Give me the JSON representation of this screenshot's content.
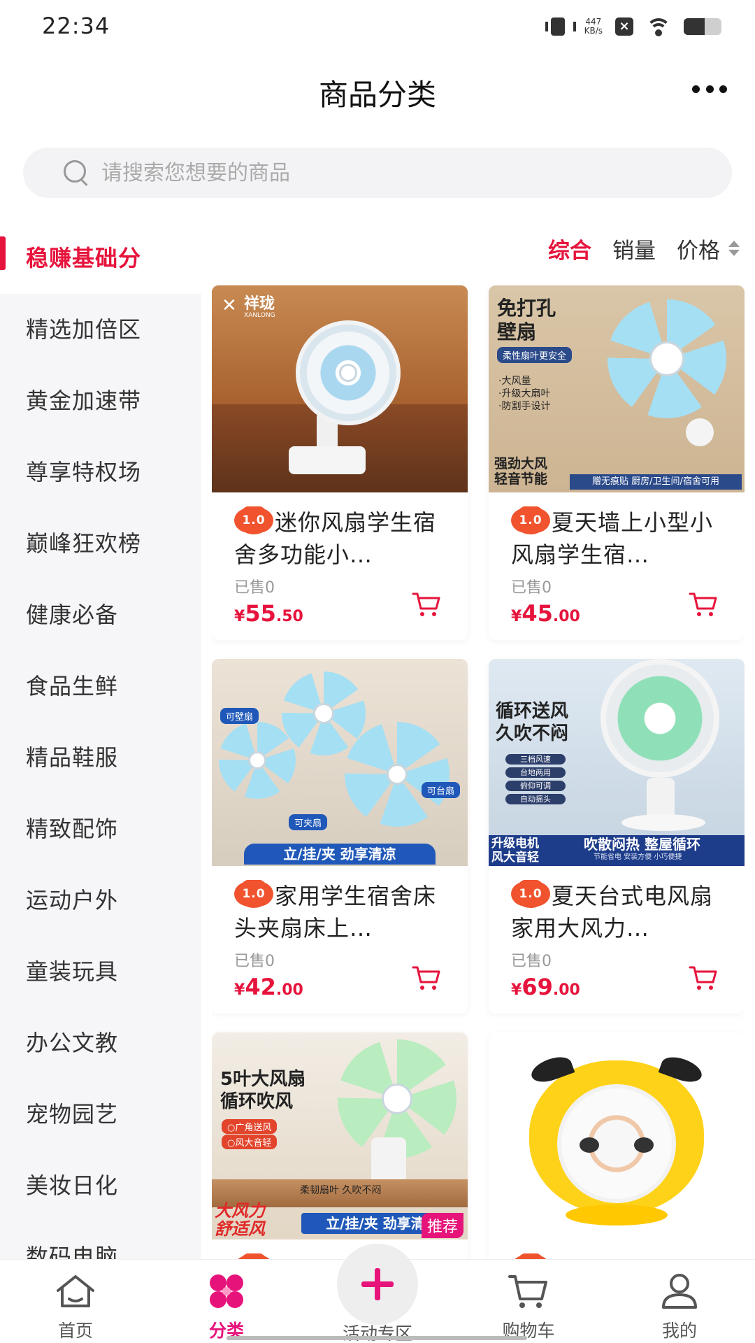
{
  "status_bar": {
    "time": "22:34",
    "net_speed_value": "447",
    "net_speed_unit": "KB/s"
  },
  "header": {
    "title": "商品分类"
  },
  "search": {
    "placeholder": "请搜索您想要的商品"
  },
  "sidebar": {
    "items": [
      {
        "label": "稳赚基础分",
        "active": true
      },
      {
        "label": "精选加倍区"
      },
      {
        "label": "黄金加速带"
      },
      {
        "label": "尊享特权场"
      },
      {
        "label": "巅峰狂欢榜"
      },
      {
        "label": "健康必备"
      },
      {
        "label": "食品生鲜"
      },
      {
        "label": "精品鞋服"
      },
      {
        "label": "精致配饰"
      },
      {
        "label": "运动户外"
      },
      {
        "label": "童装玩具"
      },
      {
        "label": "办公文教"
      },
      {
        "label": "宠物园艺"
      },
      {
        "label": "美妆日化"
      },
      {
        "label": "数码电脑"
      }
    ]
  },
  "sort": {
    "comprehensive": "综合",
    "sales": "销量",
    "price": "价格"
  },
  "products": [
    {
      "badge": "1.0",
      "title": "迷你风扇学生宿舍多功能小…",
      "sold": "已售0",
      "currency": "¥",
      "price_int": "55",
      "price_dec": ".50",
      "image_text": {
        "brand": "祥珑",
        "brand_sub": "XANLONG"
      }
    },
    {
      "badge": "1.0",
      "title": "夏天墙上小型小风扇学生宿…",
      "sold": "已售0",
      "currency": "¥",
      "price_int": "45",
      "price_dec": ".00",
      "image_text": {
        "headline1": "免打孔",
        "headline2": "壁扇",
        "tag": "柔性扇叶更安全",
        "bullets": [
          "·大风量",
          "·升级大扇叶",
          "·防割手设计"
        ],
        "bottom_left1": "强劲大风",
        "bottom_left2": "轻音节能",
        "banner": "赠无痕贴 厨房/卫生间/宿舍可用"
      }
    },
    {
      "badge": "1.0",
      "title": "家用学生宿舍床头夹扇床上…",
      "sold": "已售0",
      "currency": "¥",
      "price_int": "42",
      "price_dec": ".00",
      "image_text": {
        "tag1": "可壁扇",
        "tag2": "可台扇",
        "tag3": "可夹扇",
        "banner": "立/挂/夹 劲享清凉"
      }
    },
    {
      "badge": "1.0",
      "title": "夏天台式电风扇家用大风力…",
      "sold": "已售0",
      "currency": "¥",
      "price_int": "69",
      "price_dec": ".00",
      "image_text": {
        "headline1": "循环送风",
        "headline2": "久吹不闷",
        "bullets": [
          "三档风速",
          "台地两用",
          "俯仰可调",
          "自动摇头"
        ],
        "bottom_left1": "升级电机",
        "bottom_left2": "风大音轻",
        "banner": "吹散闷热 整屋循环",
        "banner_sub": "节能省电  安装方便  小巧便捷"
      }
    },
    {
      "title": "",
      "image_text": {
        "headline1": "5叶大风扇",
        "headline2": "循环吹风",
        "bullets": [
          "○广角送风",
          "○风大音轻"
        ],
        "sub": "柔韧扇叶 久吹不闷",
        "bottom_left1": "大风力",
        "bottom_left2": "舒适风",
        "banner": "立/挂/夹 劲享清凉",
        "recommend": "推荐"
      }
    },
    {
      "title": ""
    }
  ],
  "tabbar": {
    "items": [
      {
        "label": "首页"
      },
      {
        "label": "分类",
        "active": true
      },
      {
        "label": "活动专区"
      },
      {
        "label": "购物车"
      },
      {
        "label": "我的"
      }
    ]
  },
  "colors": {
    "accent": "#e6143c",
    "tab_active": "#e6147a",
    "badge": "#f0532e"
  }
}
